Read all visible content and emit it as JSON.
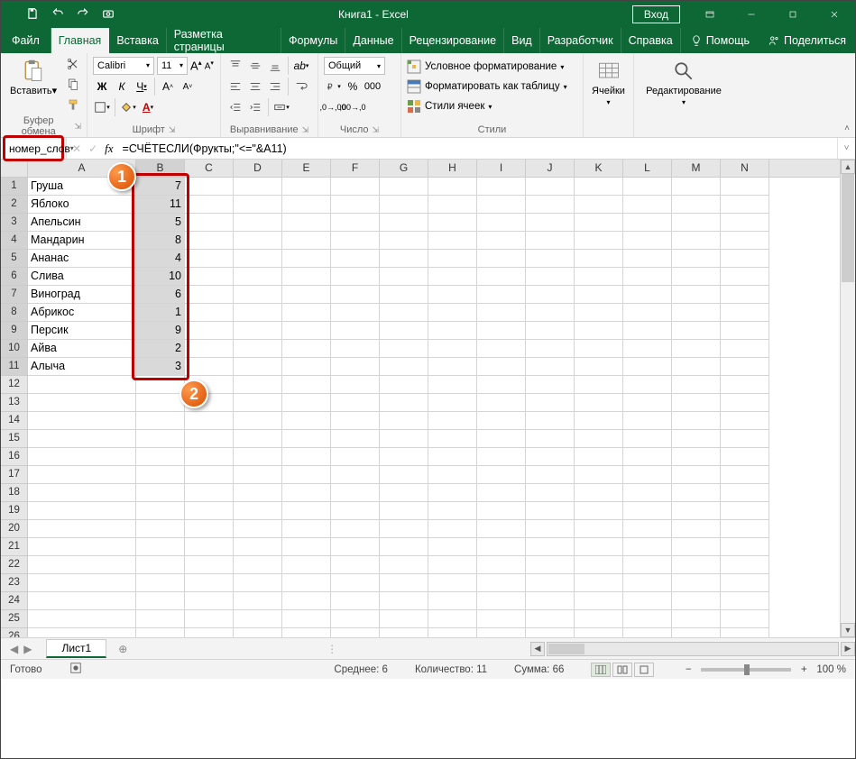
{
  "titlebar": {
    "title": "Книга1  -  Excel",
    "login": "Вход"
  },
  "tabs": {
    "file": "Файл",
    "home": "Главная",
    "insert": "Вставка",
    "layout": "Разметка страницы",
    "formulas": "Формулы",
    "data": "Данные",
    "review": "Рецензирование",
    "view": "Вид",
    "developer": "Разработчик",
    "help": "Справка",
    "tell": "Помощь",
    "share": "Поделиться"
  },
  "ribbon": {
    "clipboard": {
      "label": "Буфер обмена",
      "paste": "Вставить"
    },
    "font": {
      "label": "Шрифт",
      "name": "Calibri",
      "size": "11",
      "bold": "Ж",
      "italic": "К",
      "underline": "Ч"
    },
    "alignment": {
      "label": "Выравнивание"
    },
    "number": {
      "label": "Число",
      "format": "Общий"
    },
    "styles": {
      "label": "Стили",
      "cond": "Условное форматирование",
      "table": "Форматировать как таблицу",
      "cell": "Стили ячеек"
    },
    "cells": {
      "label": "Ячейки"
    },
    "editing": {
      "label": "Редактирование"
    }
  },
  "formula_bar": {
    "name_box": "номер_слов",
    "formula": "=СЧЁТЕСЛИ(Фрукты;\"<=\"&A11)"
  },
  "columns": [
    "A",
    "B",
    "C",
    "D",
    "E",
    "F",
    "G",
    "H",
    "I",
    "J",
    "K",
    "L",
    "M",
    "N"
  ],
  "col_widths": {
    "A": 120,
    "B": 54,
    "C": 54,
    "D": 54,
    "E": 54,
    "F": 54,
    "G": 54,
    "H": 54,
    "I": 54,
    "J": 54,
    "K": 54,
    "L": 54,
    "M": 54,
    "N": 54
  },
  "row_count": 26,
  "selected_col": "B",
  "selected_rows_from": 1,
  "selected_rows_to": 11,
  "data_rows": [
    {
      "A": "Груша",
      "B": "7"
    },
    {
      "A": "Яблоко",
      "B": "11"
    },
    {
      "A": "Апельсин",
      "B": "5"
    },
    {
      "A": "Мандарин",
      "B": "8"
    },
    {
      "A": "Ананас",
      "B": "4"
    },
    {
      "A": "Слива",
      "B": "10"
    },
    {
      "A": "Виноград",
      "B": "6"
    },
    {
      "A": "Абрикос",
      "B": "1"
    },
    {
      "A": "Персик",
      "B": "9"
    },
    {
      "A": "Айва",
      "B": "2"
    },
    {
      "A": "Алыча",
      "B": "3"
    }
  ],
  "sheet": {
    "name": "Лист1"
  },
  "status": {
    "ready": "Готово",
    "avg_label": "Среднее:",
    "avg": "6",
    "count_label": "Количество:",
    "count": "11",
    "sum_label": "Сумма:",
    "sum": "66",
    "zoom": "100 %"
  },
  "callouts": {
    "one": "1",
    "two": "2"
  }
}
